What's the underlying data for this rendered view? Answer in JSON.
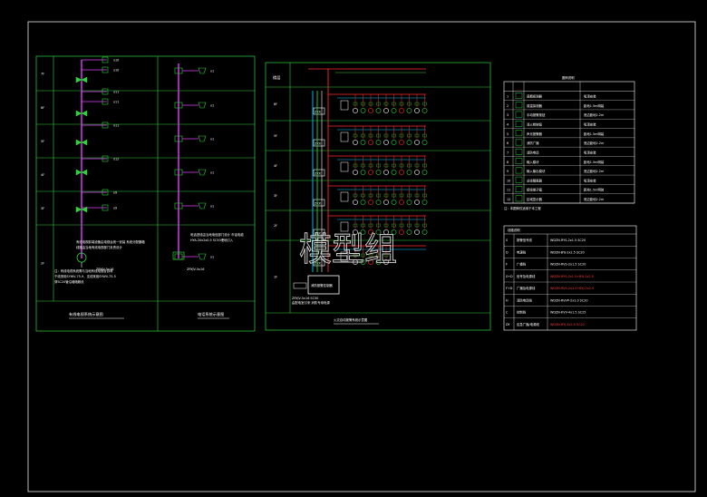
{
  "watermark": "模型组",
  "left_panel": {
    "floors": [
      "7F",
      "6F",
      "5F",
      "4F",
      "3F",
      "2F",
      "1F"
    ],
    "cable_label": "ZRYJV-5x16",
    "tv_outlets": [
      "x10",
      "x10",
      "x11",
      "x11",
      "x11",
      "x12",
      "x9",
      "x9"
    ],
    "title_tv": "有线电视系统示意图",
    "title_tel": "电话系统示意图",
    "tel_outlets": [
      "x1",
      "x1",
      "x1",
      "x1",
      "x1",
      "x1"
    ]
  },
  "middle_panel": {
    "floor_header": "楼层",
    "floors": [
      "6F",
      "5F",
      "4F",
      "3F",
      "2F",
      "1F"
    ],
    "box_label": "ZXX",
    "main_box": "消防报警控制器",
    "title": "火灾自动报警系统示意图"
  },
  "legend_table": {
    "title": "图例说明",
    "rows": [
      "感烟探测器",
      "感温探测器",
      "手动报警按钮",
      "消火栓按钮",
      "声光报警器",
      "消防广播",
      "消防电话",
      "输入模块",
      "输入输出模块",
      "总线隔离器",
      "接线端子箱",
      "区域显示器"
    ],
    "notes": [
      "吸顶安装",
      "距地1.5m明装",
      "底边距地2.2m"
    ],
    "footnote": "注：本图例仅适用于本工程"
  },
  "wiring_table": {
    "title": "线路说明",
    "rows": [
      {
        "code": "S",
        "name": "报警信号线",
        "spec": "WDZN-RYS-2x1.5 SC20"
      },
      {
        "code": "D",
        "name": "电源线",
        "spec": "WDZN-BYJ-2x2.5 SC20"
      },
      {
        "code": "F",
        "name": "广播线",
        "spec": "WDZN-RVS-2x1.5 SC20"
      },
      {
        "code": "S+D",
        "name": "信号及电源线",
        "spec": "WDZN-RYS-2x1.5+BYJ-2x2.5"
      },
      {
        "code": "F+D",
        "name": "广播及电源线",
        "spec": "WDZN-RVS-2x1.5+BYJ-2x2.5"
      },
      {
        "code": "H",
        "name": "消防电话线",
        "spec": "WDZN-RVVP-2x1.0 SC20"
      },
      {
        "code": "C",
        "name": "控制线",
        "spec": "WDZN-KVV-4x1.5 SC25"
      },
      {
        "code": "DY",
        "name": "应急广播/电源线",
        "spec": "WDZN-BYJ-3x2.5 SC20"
      }
    ]
  }
}
